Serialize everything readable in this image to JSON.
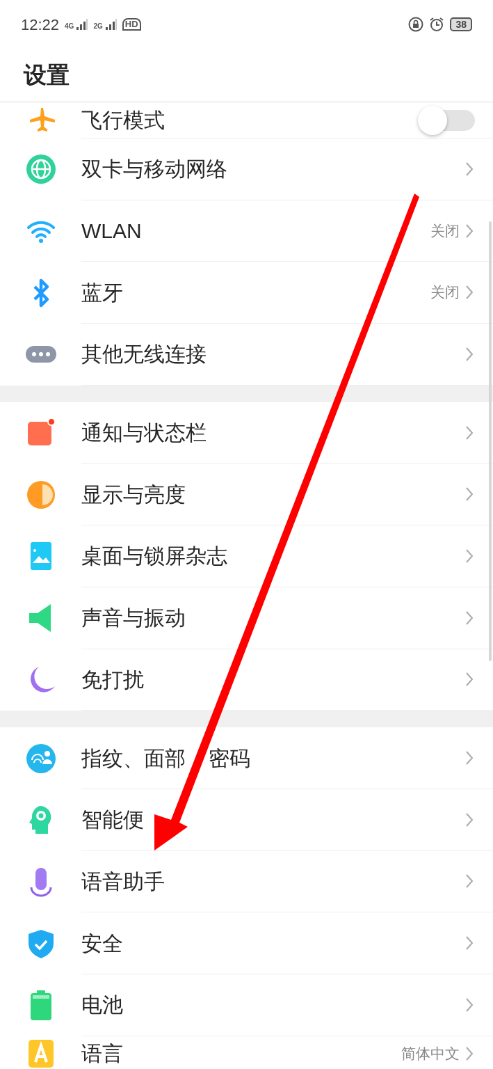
{
  "status_bar": {
    "time": "12:22",
    "networks": [
      "4G",
      "2G"
    ],
    "hd": "HD",
    "battery": "38"
  },
  "title": "设置",
  "sections": [
    {
      "items": [
        {
          "kind": "toggle",
          "label": "飞行模式",
          "on": false
        },
        {
          "kind": "link",
          "label": "双卡与移动网络"
        },
        {
          "kind": "link",
          "label": "WLAN",
          "value": "关闭"
        },
        {
          "kind": "link",
          "label": "蓝牙",
          "value": "关闭"
        },
        {
          "kind": "link",
          "label": "其他无线连接"
        }
      ]
    },
    {
      "items": [
        {
          "kind": "link",
          "label": "通知与状态栏"
        },
        {
          "kind": "link",
          "label": "显示与亮度"
        },
        {
          "kind": "link",
          "label": "桌面与锁屏杂志"
        },
        {
          "kind": "link",
          "label": "声音与振动"
        },
        {
          "kind": "link",
          "label": "免打扰"
        }
      ]
    },
    {
      "items": [
        {
          "kind": "link",
          "label_parts": [
            "指纹、面部",
            "密码"
          ]
        },
        {
          "kind": "link",
          "label": "智能便"
        },
        {
          "kind": "link",
          "label": "语音助手"
        },
        {
          "kind": "link",
          "label": "安全"
        },
        {
          "kind": "link",
          "label": "电池"
        },
        {
          "kind": "link",
          "label": "语言",
          "value": "简体中文"
        }
      ]
    }
  ]
}
